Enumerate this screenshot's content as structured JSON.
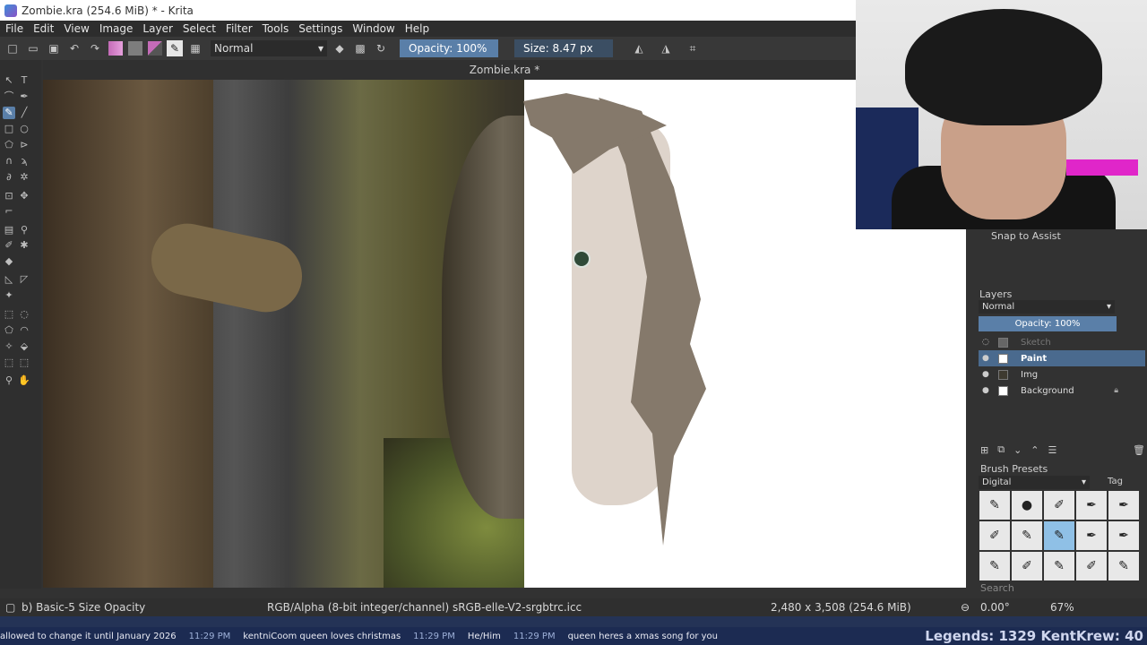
{
  "window": {
    "title": "Zombie.kra (254.6 MiB)  * - Krita",
    "controls": [
      "—",
      "❐",
      "✕"
    ]
  },
  "menu": [
    "File",
    "Edit",
    "View",
    "Image",
    "Layer",
    "Select",
    "Filter",
    "Tools",
    "Settings",
    "Window",
    "Help"
  ],
  "toolbar": {
    "blend_mode": "Normal",
    "opacity": "Opacity: 100%",
    "size": "Size: 8.47 px",
    "fg_color": "#c46bb8",
    "bg_color": "#7d7d7d"
  },
  "document": {
    "tab_title": "Zombie.kra *"
  },
  "docker": {
    "snap_label": "Snap to Assist",
    "layers_title": "Layers",
    "layers_blend": "Normal",
    "layers_opacity": "Opacity:  100%",
    "layers": [
      {
        "name": "Sketch",
        "state": "dim"
      },
      {
        "name": "Paint",
        "state": "active"
      },
      {
        "name": "Img",
        "state": "normal"
      },
      {
        "name": "Background",
        "state": "locked"
      }
    ],
    "presets_title": "Brush Presets",
    "presets_tag": "Digital",
    "tag_label": "Tag",
    "search_label": "Search"
  },
  "status": {
    "brush": "b) Basic-5 Size Opacity",
    "color_space": "RGB/Alpha (8-bit integer/channel)  sRGB-elle-V2-srgbtrc.icc",
    "dimensions": "2,480 x 3,508 (254.6 MiB)",
    "rotation": "0.00°",
    "zoom": "67%"
  },
  "ticker": {
    "messages": [
      "allowed to change it until January 2026",
      "11:29 PM",
      "kentniCoom  queen loves christmas",
      "11:29 PM",
      "He/Him",
      "11:29 PM",
      "queen heres a xmas song for you"
    ],
    "legends": "Legends: 1329 KentKrew: 40"
  }
}
